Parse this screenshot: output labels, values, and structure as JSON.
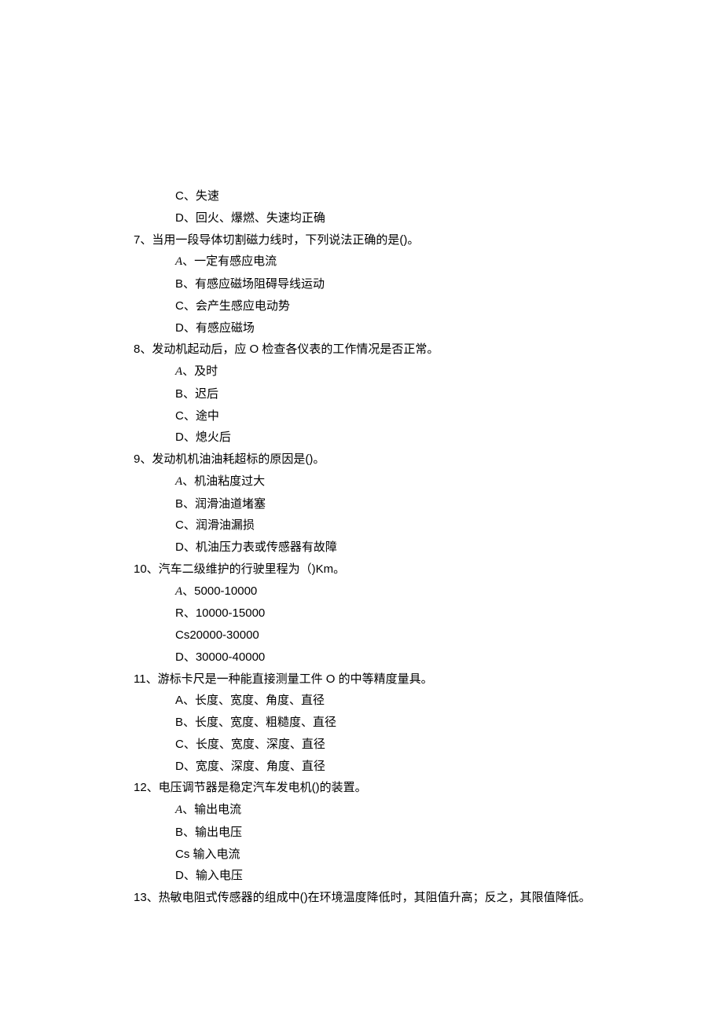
{
  "lines": [
    {
      "cls": "option",
      "text": "C、失速"
    },
    {
      "cls": "option",
      "text": "D、回火、爆燃、失速均正确"
    },
    {
      "cls": "question",
      "text": "7、当用一段导体切割磁力线时，下列说法正确的是()。"
    },
    {
      "cls": "option",
      "prefix_italic": "A",
      "text": "、一定有感应电流"
    },
    {
      "cls": "option",
      "text": "B、有感应磁场阻碍导线运动"
    },
    {
      "cls": "option",
      "text": "C、会产生感应电动势"
    },
    {
      "cls": "option",
      "text": "D、有感应磁场"
    },
    {
      "cls": "question",
      "text": "8、发动机起动后，应 O 检查各仪表的工作情况是否正常。"
    },
    {
      "cls": "option",
      "prefix_italic": "A",
      "text": "、及时"
    },
    {
      "cls": "option",
      "text": "B、迟后"
    },
    {
      "cls": "option",
      "text": "C、途中"
    },
    {
      "cls": "option",
      "text": "D、熄火后"
    },
    {
      "cls": "question",
      "text": "9、发动机机油油耗超标的原因是()。"
    },
    {
      "cls": "option",
      "prefix_italic": "A",
      "text": "、机油粘度过大"
    },
    {
      "cls": "option",
      "text": "B、润滑油道堵塞"
    },
    {
      "cls": "option",
      "text": "C、润滑油漏损"
    },
    {
      "cls": "option",
      "text": "D、机油压力表或传感器有故障"
    },
    {
      "cls": "question",
      "text": "10、汽车二级维护的行驶里程为（)Km。"
    },
    {
      "cls": "option",
      "prefix_italic": "A",
      "text": "、5000-10000"
    },
    {
      "cls": "option",
      "text": "R、10000-15000"
    },
    {
      "cls": "option",
      "text": "Cs20000-30000"
    },
    {
      "cls": "option",
      "text": "D、30000-40000"
    },
    {
      "cls": "question",
      "text": "11、游标卡尺是一种能直接测量工件 O 的中等精度量具。"
    },
    {
      "cls": "option",
      "text": "A、长度、宽度、角度、直径"
    },
    {
      "cls": "option",
      "text": "B、长度、宽度、粗糙度、直径"
    },
    {
      "cls": "option",
      "text": "C、长度、宽度、深度、直径"
    },
    {
      "cls": "option",
      "text": "D、宽度、深度、角度、直径"
    },
    {
      "cls": "question",
      "text": "12、电压调节器是稳定汽车发电机()的装置。"
    },
    {
      "cls": "option",
      "prefix_italic": "A",
      "text": "、输出电流"
    },
    {
      "cls": "option",
      "text": "B、输出电压"
    },
    {
      "cls": "option",
      "text": "Cs 输入电流"
    },
    {
      "cls": "option",
      "text": "D、输入电压"
    },
    {
      "cls": "question",
      "text": "13、热敏电阻式传感器的组成中()在环境温度降低时，其阻值升高；反之，其限值降低。"
    }
  ]
}
